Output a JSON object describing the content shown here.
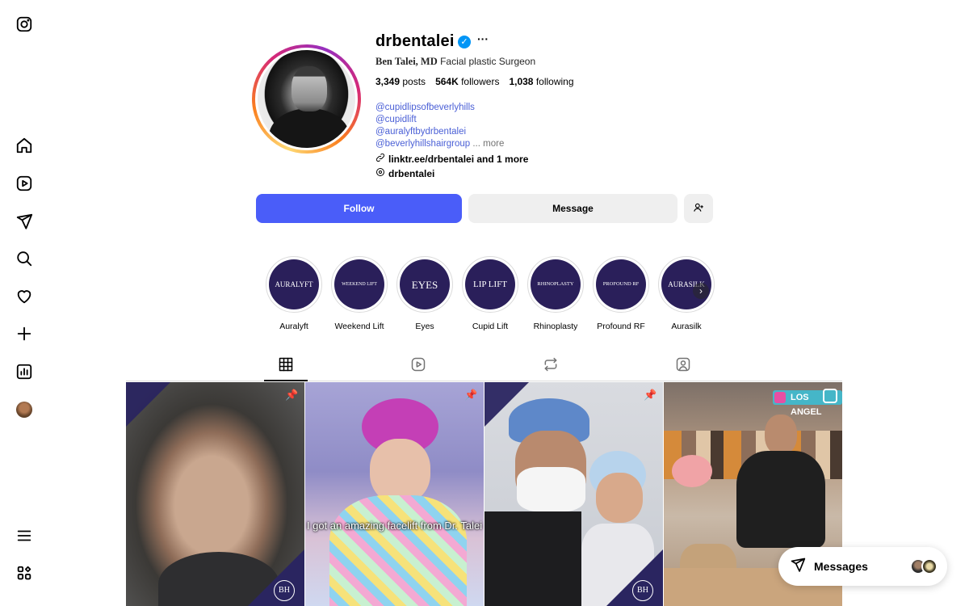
{
  "profile": {
    "username": "drbentalei",
    "verified_glyph": "✓",
    "more_glyph": "···",
    "name": "Ben Talei, MD",
    "category": "Facial plastic Surgeon",
    "posts_count": "3,349",
    "posts_label": "posts",
    "followers_count": "564K",
    "followers_label": "followers",
    "following_count": "1,038",
    "following_label": "following",
    "bio_mentions": [
      "@cupidlipsofbeverlyhills",
      "@cupidlift",
      "@auralyftbydrbentalei",
      "@beverlyhillshairgroup"
    ],
    "bio_more": "... more",
    "link": "linktr.ee/drbentalei and 1 more",
    "threads": "drbentalei"
  },
  "actions": {
    "follow": "Follow",
    "message": "Message"
  },
  "highlights": [
    {
      "cover": "AURALYFT",
      "label": "Auralyft"
    },
    {
      "cover": "WEEKEND LIFT",
      "label": "Weekend Lift"
    },
    {
      "cover": "EYES",
      "label": "Eyes"
    },
    {
      "cover": "LIP LIFT",
      "label": "Cupid Lift"
    },
    {
      "cover": "RHINOPLASTY",
      "label": "Rhinoplasty"
    },
    {
      "cover": "PROFOUND RF",
      "label": "Profound RF"
    },
    {
      "cover": "AURASILK",
      "label": "Aurasilk"
    }
  ],
  "posts": {
    "caption_2": "I got an amazing facelift from Dr. Talei",
    "badge_4": "LOS ANGEL",
    "logo_text": "BH"
  },
  "messages": {
    "label": "Messages"
  },
  "colors": {
    "follow_button": "#4a5df9",
    "highlight_bg": "#2a1f5a",
    "link_blue": "#4a5fd6",
    "verified_blue": "#0095f6"
  },
  "icons": [
    "instagram-icon",
    "home-icon",
    "reels-icon",
    "explore-icon",
    "search-icon",
    "heart-icon",
    "create-icon",
    "dashboard-icon",
    "more-menu-icon",
    "meta-apps-icon",
    "grid-icon",
    "reels-tab-icon",
    "reposts-icon",
    "tagged-icon",
    "pin-icon",
    "link-icon",
    "threads-icon",
    "add-user-icon",
    "send-icon"
  ]
}
